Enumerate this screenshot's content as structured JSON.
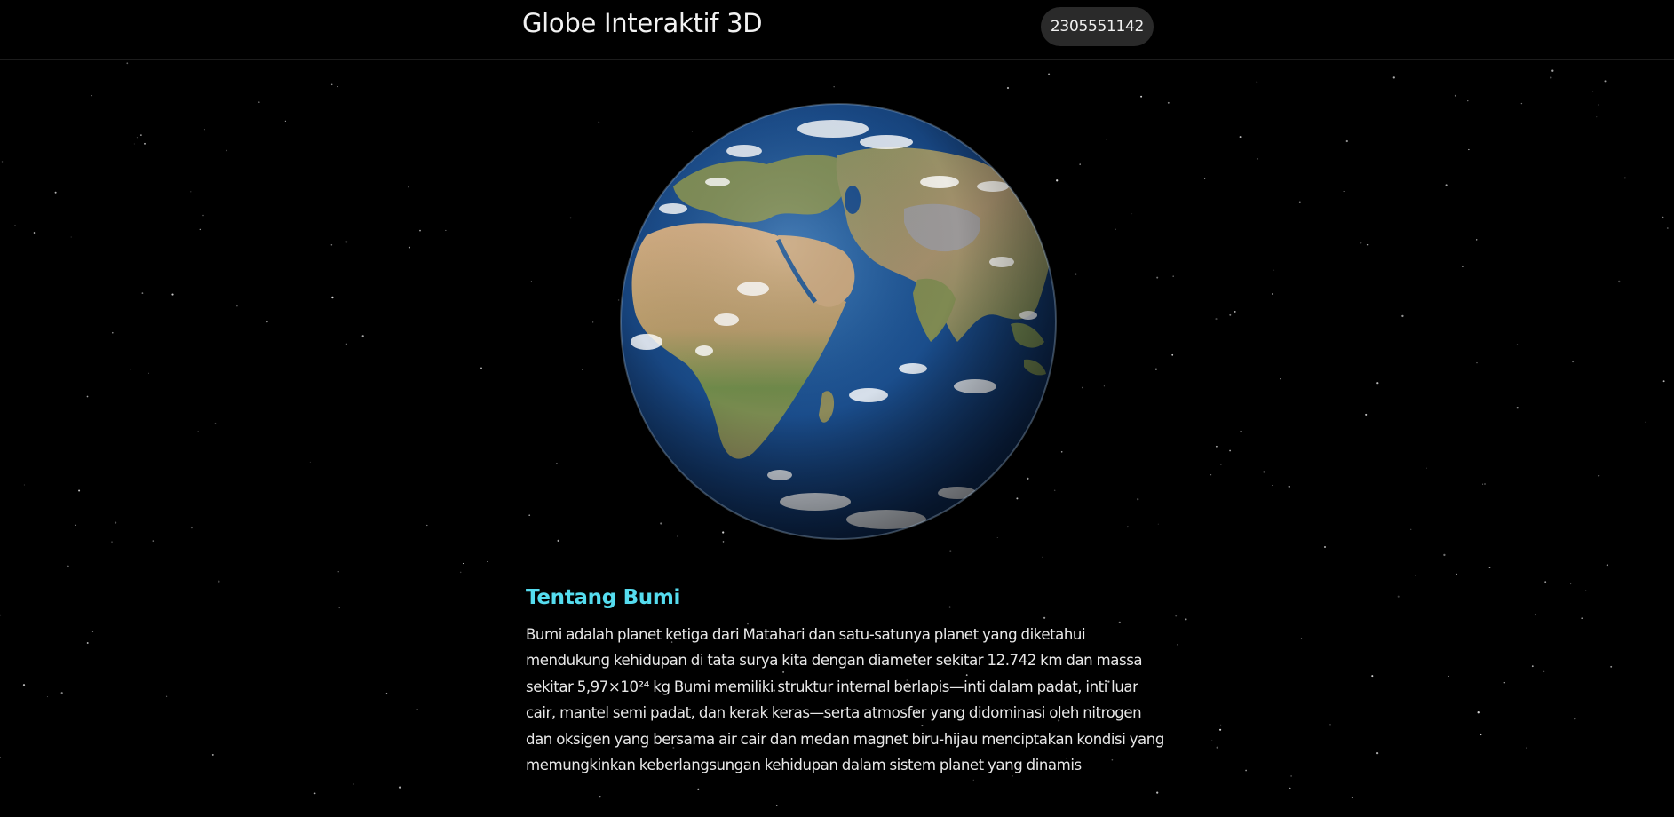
{
  "header": {
    "title": "Globe Interaktif 3D",
    "badge": "2305551142"
  },
  "about": {
    "heading": "Tentang Bumi",
    "body": "Bumi adalah planet ketiga dari Matahari dan satu-satunya planet yang diketahui mendukung kehidupan di tata surya kita dengan diameter sekitar 12.742 km dan massa sekitar 5,97×10²⁴ kg Bumi memiliki struktur internal berlapis—inti dalam padat, inti luar cair, mantel semi padat, dan kerak keras—serta atmosfer yang didominasi oleh nitrogen dan oksigen yang bersama air cair dan medan magnet biru-hijau menciptakan kondisi yang memungkinkan keberlangsungan kehidupan dalam sistem planet yang dinamis"
  },
  "colors": {
    "background": "#000000",
    "accent": "#55dcef",
    "badge_bg": "#2a2a2a",
    "ocean": "#1c4d8a",
    "land": "#7f8a55",
    "desert": "#c9a77c"
  }
}
